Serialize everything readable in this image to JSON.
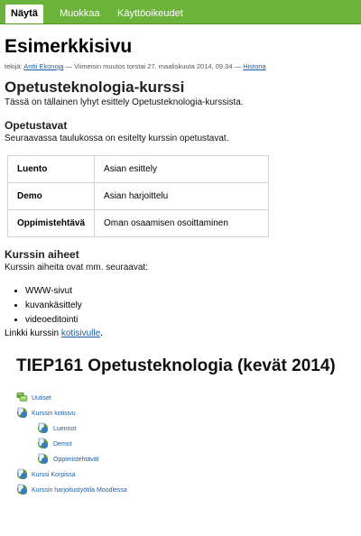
{
  "tabs": [
    {
      "label": "Näytä"
    },
    {
      "label": "Muokkaa"
    },
    {
      "label": "Käyttöoikeudet"
    }
  ],
  "page": {
    "title": "Esimerkkisivu",
    "meta_prefix": "tekijä: ",
    "meta_author": "Antti Ekonoja",
    "meta_middle": " — Viimeisin muutos torstai 27. maaliskuuta 2014, 09.34 — ",
    "meta_history": "Historia"
  },
  "course": {
    "heading": "Opetusteknologia-kurssi",
    "intro": "Tässä on tällainen lyhyt esittely Opetusteknologia-kurssista."
  },
  "methods": {
    "heading": "Opetustavat",
    "intro": "Seuraavassa taulukossa on esitelty kurssin opetustavat.",
    "rows": [
      {
        "name": "Luento",
        "desc": "Asian esittely"
      },
      {
        "name": "Demo",
        "desc": "Asian harjoittelu"
      },
      {
        "name": "Oppimistehtävä",
        "desc": "Oman osaamisen osoittaminen"
      }
    ]
  },
  "topics": {
    "heading": "Kurssin aiheet",
    "intro": "Kurssin aiheita ovat mm. seuraavat:",
    "items": [
      "WWW-sivut",
      "kuvankäsittely",
      "videoeditointi"
    ],
    "link_prefix": "Linkki kurssin ",
    "link_text": "kotisivulle",
    "link_suffix": "."
  },
  "tree": {
    "title": "TIEP161 Opetusteknologia (kevät 2014)",
    "items": [
      {
        "label": "Uutiset",
        "icon": "forum-icon"
      },
      {
        "label": "Kurssin kotisivu",
        "icon": "page-icon"
      },
      {
        "label": "Luennot",
        "icon": "page-icon"
      },
      {
        "label": "Demot",
        "icon": "page-icon"
      },
      {
        "label": "Oppimistehtävät",
        "icon": "page-icon"
      },
      {
        "label": "Kurssi Korpissa",
        "icon": "page-icon"
      },
      {
        "label": "Kurssin harjoitustyötila Moodlessa",
        "icon": "page-icon"
      }
    ]
  },
  "colors": {
    "tabbar": "#6bb33a",
    "link": "#1a5ea8"
  }
}
